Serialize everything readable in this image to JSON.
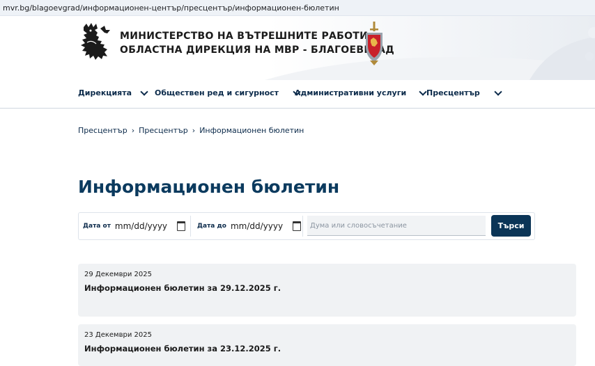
{
  "browser": {
    "url": "mvr.bg/blagoevgrad/информационен-център/пресцентър/информационен-бюлетин"
  },
  "header": {
    "title_line1": "МИНИСТЕРСТВО НА ВЪТРЕШНИТЕ РАБОТИ",
    "title_line2": "ОБЛАСТНА ДИРЕКЦИЯ НА МВР - БЛАГОЕВГРАД",
    "logo_icon": "lion-coat-of-arms-icon",
    "crest_icon": "mvr-crest-icon",
    "crest_red": "#c8202a"
  },
  "nav": {
    "items": [
      {
        "label": "Дирекцията"
      },
      {
        "label": "Обществен ред и сигурност"
      },
      {
        "label": "Административни услуги"
      },
      {
        "label": "Пресцентър"
      }
    ]
  },
  "breadcrumb": {
    "items": [
      {
        "label": "Пресцентър"
      },
      {
        "label": "Пресцентър"
      },
      {
        "label": "Информационен бюлетин"
      }
    ],
    "separator": "›"
  },
  "page": {
    "title": "Информационен бюлетин"
  },
  "filter": {
    "date_from_label": "Дата от",
    "date_from_value": "mm/dd/yyyy",
    "date_to_label": "Дата до",
    "date_to_value": "mm/dd/yyyy",
    "search_placeholder": "Дума или словосъчетание",
    "search_button": "Търси"
  },
  "results": [
    {
      "date": "29 Декември 2025",
      "title": "Информационен бюлетин за 29.12.2025 г."
    },
    {
      "date": "23 Декември 2025",
      "title": "Информационен бюлетин за 23.12.2025 г."
    }
  ],
  "colors": {
    "primary": "#0b3557",
    "card_bg": "#f0f2f4",
    "accent_red": "#c8202a"
  }
}
